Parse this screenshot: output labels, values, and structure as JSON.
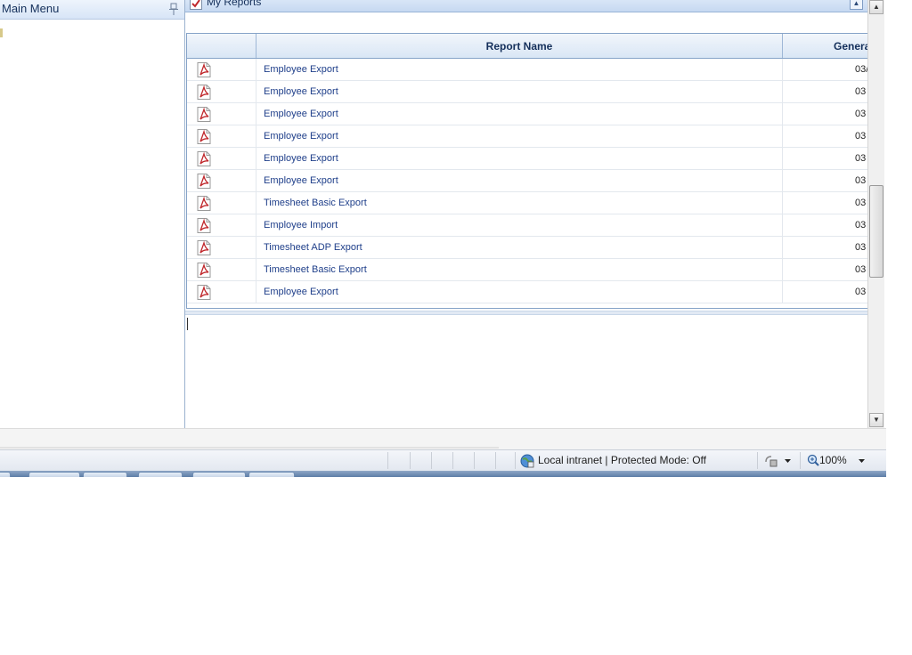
{
  "main_menu": {
    "title": "Main Menu"
  },
  "reports_panel": {
    "title": "My Reports",
    "columns": {
      "name": "Report Name",
      "generated": "Genera"
    },
    "rows": [
      {
        "name": "Employee Export",
        "generated": "03/"
      },
      {
        "name": "Employee Export",
        "generated": "03"
      },
      {
        "name": "Employee Export",
        "generated": "03"
      },
      {
        "name": "Employee Export",
        "generated": "03"
      },
      {
        "name": "Employee Export",
        "generated": "03"
      },
      {
        "name": "Employee Export",
        "generated": "03"
      },
      {
        "name": "Timesheet Basic Export",
        "generated": "03"
      },
      {
        "name": "Employee Import",
        "generated": "03"
      },
      {
        "name": "Timesheet ADP Export",
        "generated": "03"
      },
      {
        "name": "Timesheet Basic Export",
        "generated": "03"
      },
      {
        "name": "Employee Export",
        "generated": "03"
      }
    ]
  },
  "status_bar": {
    "zone": "Local intranet | Protected Mode: Off",
    "zoom": "100%"
  },
  "icons": {
    "row": "pdf-icon",
    "panel": "check-icon",
    "menu_pin": "pin-icon",
    "zone": "globe-icon",
    "zoom": "zoom-icon"
  },
  "colors": {
    "link": "#1f3f8a",
    "header_text": "#15305b",
    "panel_header": "#c6d9f1",
    "pdf_red": "#c0282c"
  }
}
